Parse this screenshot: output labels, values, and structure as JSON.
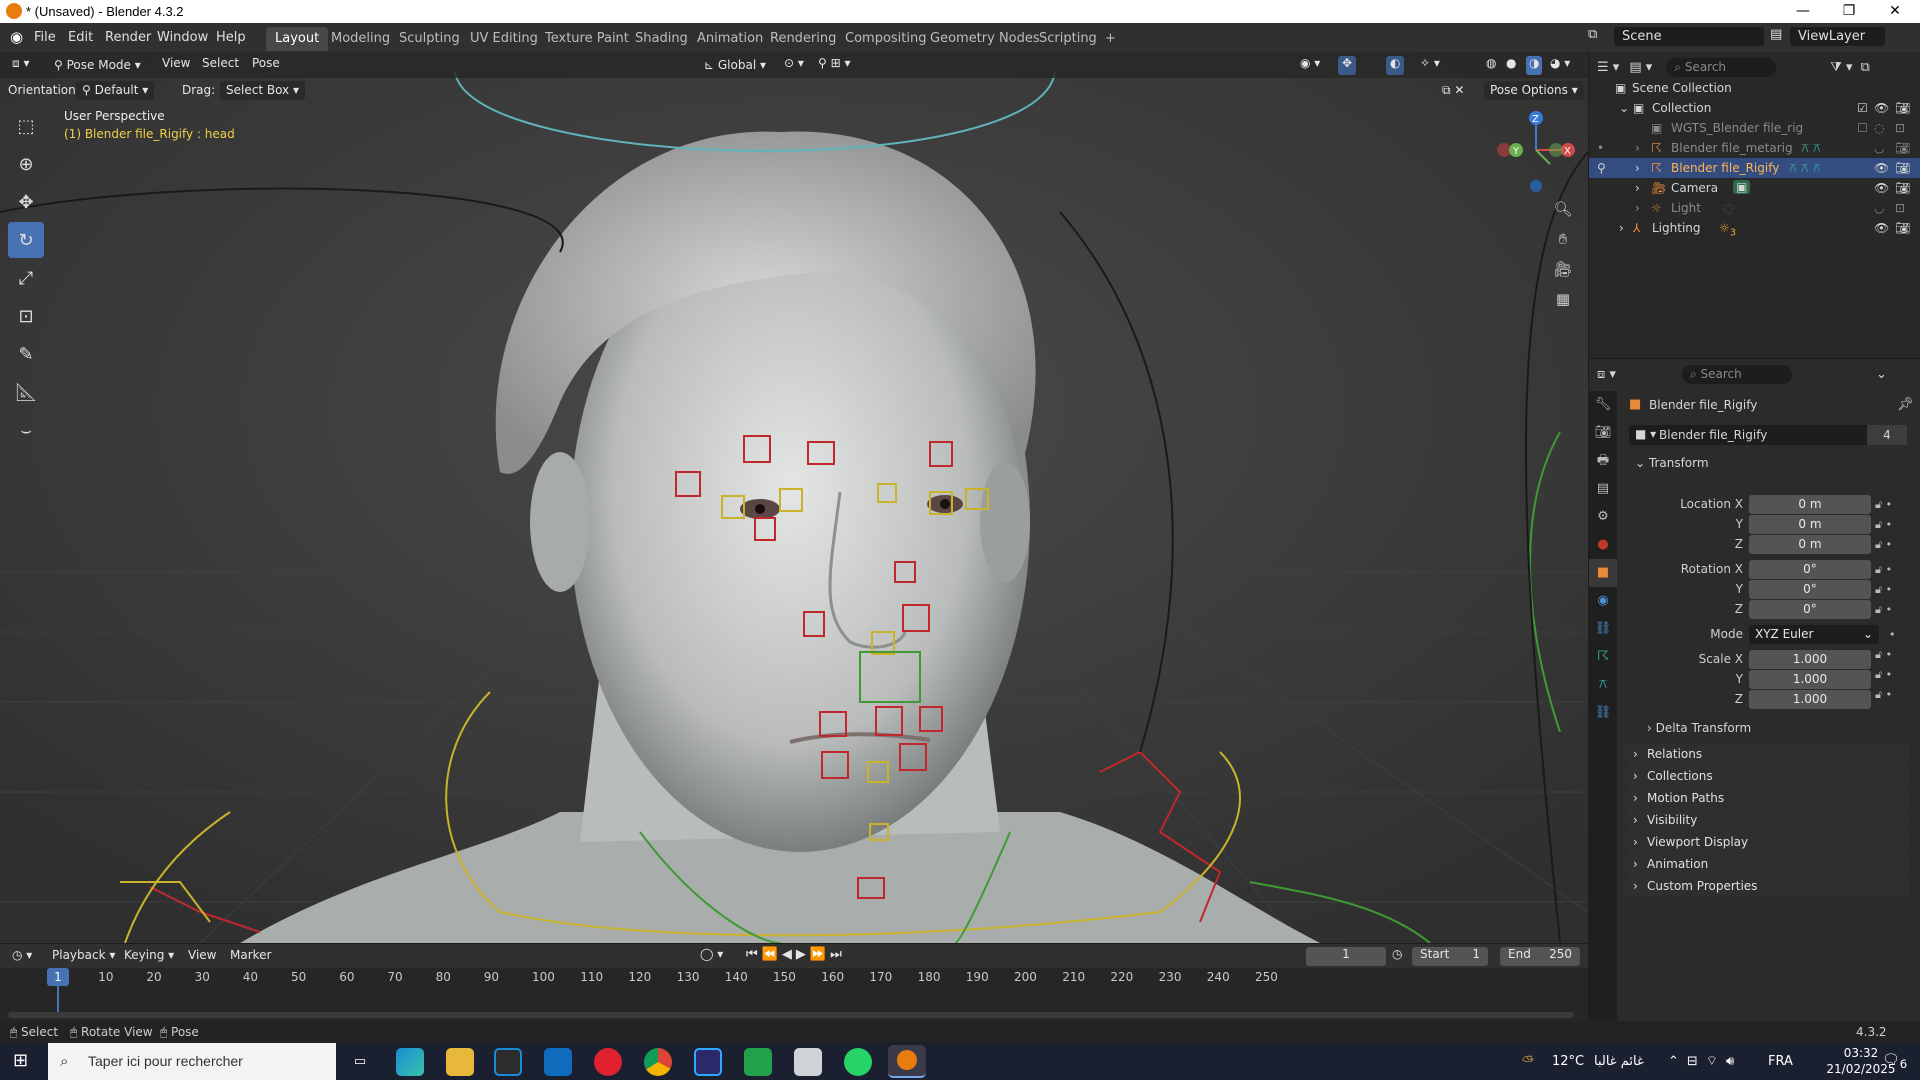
{
  "window": {
    "title": "* (Unsaved) - Blender 4.3.2",
    "controls": [
      "—",
      "❐",
      "✕"
    ]
  },
  "menubar": {
    "menus": [
      "File",
      "Edit",
      "Render",
      "Window",
      "Help"
    ],
    "workspaces": [
      "Layout",
      "Modeling",
      "Sculpting",
      "UV Editing",
      "Texture Paint",
      "Shading",
      "Animation",
      "Rendering",
      "Compositing",
      "Geometry Nodes",
      "Scripting"
    ],
    "active_workspace": "Layout",
    "add_tab": "+",
    "scene_label": "Scene",
    "viewlayer_label": "ViewLayer"
  },
  "viewport": {
    "mode": "Pose Mode",
    "menus": [
      "View",
      "Select",
      "Pose"
    ],
    "transform_orientation": "Global",
    "orientation_label": "Orientation:",
    "orientation_value": "Default",
    "drag_label": "Drag:",
    "drag_value": "Select Box",
    "pose_options": "Pose Options",
    "perspective_text": "User Perspective",
    "active_object_text": "(1) Blender file_Rigify : head",
    "tools": [
      "select-box",
      "cursor",
      "move",
      "rotate",
      "scale",
      "transform",
      "annotate",
      "measure",
      "bone-relax"
    ],
    "active_tool": "rotate",
    "gizmo": {
      "x": "X",
      "y": "Y",
      "z": "Z"
    }
  },
  "outliner": {
    "search_placeholder": "Search",
    "items": [
      {
        "label": "Scene Collection",
        "indent": 0,
        "type": "collection"
      },
      {
        "label": "Collection",
        "indent": 1,
        "type": "collection"
      },
      {
        "label": "WGTS_Blender file_rig",
        "indent": 2,
        "type": "collection",
        "dim": true
      },
      {
        "label": "Blender file_metarig",
        "indent": 2,
        "type": "armature",
        "dim": true
      },
      {
        "label": "Blender file_Rigify",
        "indent": 2,
        "type": "armature",
        "selected": true
      },
      {
        "label": "Camera",
        "indent": 2,
        "type": "camera"
      },
      {
        "label": "Light",
        "indent": 2,
        "type": "light",
        "dim": true
      },
      {
        "label": "Lighting",
        "indent": 1,
        "type": "empty"
      }
    ],
    "lighting_badge": "3"
  },
  "properties": {
    "search_placeholder": "Search",
    "object_name": "Blender file_Rigify",
    "datablock_name": "Blender file_Rigify",
    "datablock_users": "4",
    "transform_header": "Transform",
    "location_label": "Location X",
    "location": [
      "0 m",
      "0 m",
      "0 m"
    ],
    "rotation_label": "Rotation X",
    "rotation": [
      "0°",
      "0°",
      "0°"
    ],
    "mode_label": "Mode",
    "mode_value": "XYZ Euler",
    "scale_label": "Scale X",
    "scale": [
      "1.000",
      "1.000",
      "1.000"
    ],
    "axis_y": "Y",
    "axis_z": "Z",
    "delta_transform": "Delta Transform",
    "panels": [
      "Relations",
      "Collections",
      "Motion Paths",
      "Visibility",
      "Viewport Display",
      "Animation",
      "Custom Properties"
    ]
  },
  "timeline": {
    "menus": [
      "Playback",
      "Keying",
      "View",
      "Marker"
    ],
    "current_frame": "1",
    "start_label": "Start",
    "start_value": "1",
    "end_label": "End",
    "end_value": "250",
    "ticks": [
      "10",
      "20",
      "30",
      "40",
      "50",
      "60",
      "70",
      "80",
      "90",
      "100",
      "110",
      "120",
      "130",
      "140",
      "150",
      "160",
      "170",
      "180",
      "190",
      "200",
      "210",
      "220",
      "230",
      "240",
      "250"
    ],
    "playhead": "1"
  },
  "statusbar": {
    "items": [
      "Select",
      "Rotate View",
      "Pose"
    ],
    "version": "4.3.2"
  },
  "taskbar": {
    "search_placeholder": "Taper ici pour rechercher",
    "weather": "12°C",
    "weather_desc": "غائم غالبا",
    "lang": "FRA",
    "time": "03:32",
    "date": "21/02/2025",
    "notifications": "6"
  },
  "colors": {
    "accent": "#4772b3",
    "selected_row": "#334d80",
    "bone_red": "#c0282b",
    "bone_yellow": "#c9b32a",
    "bone_green": "#3f9a35"
  }
}
